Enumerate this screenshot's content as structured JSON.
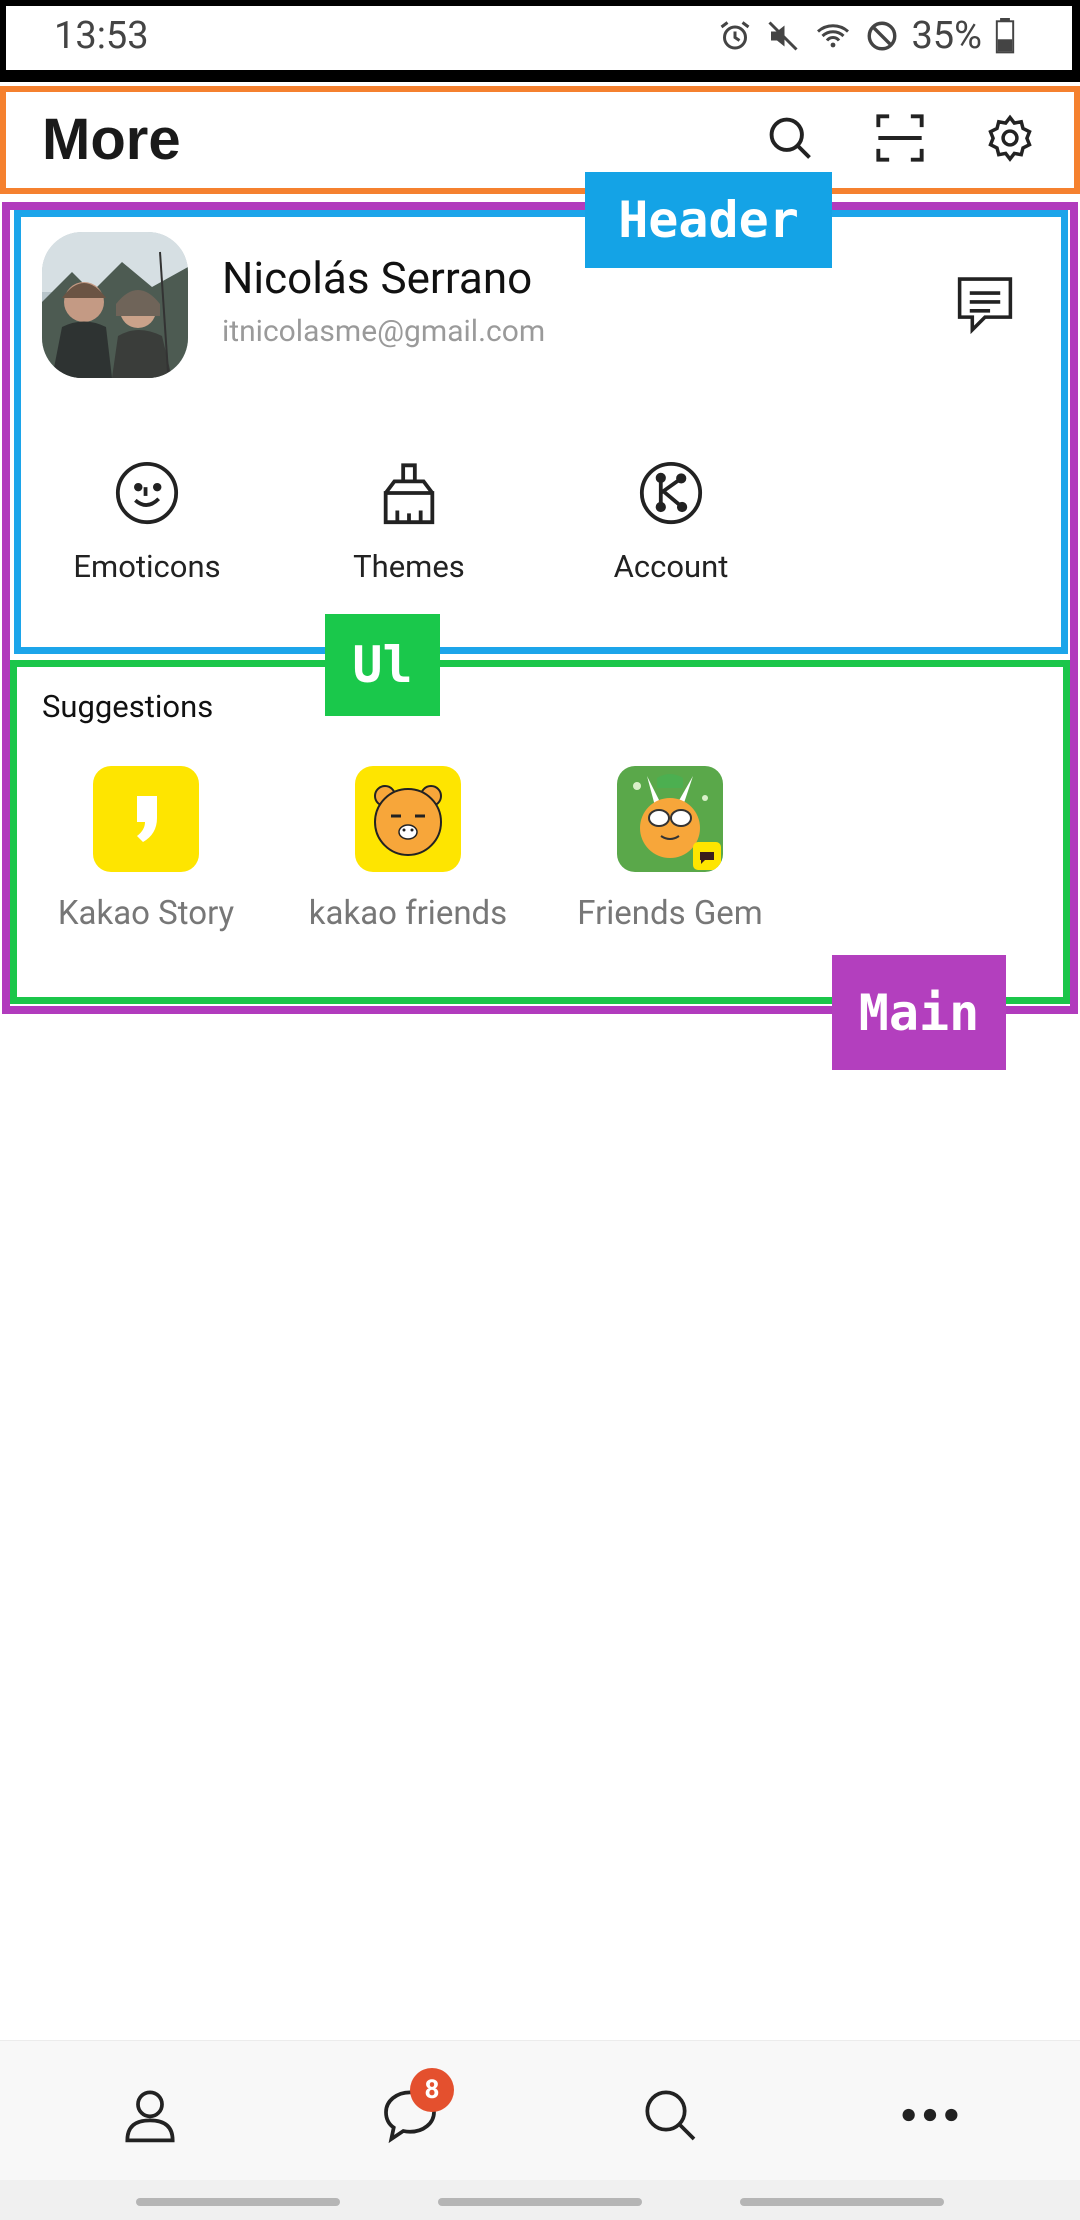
{
  "status_bar": {
    "time": "13:53",
    "battery": "35%",
    "icons": [
      "alarm-icon",
      "mute-icon",
      "wifi-icon",
      "do-not-disturb-icon",
      "battery-icon"
    ]
  },
  "header": {
    "title": "More",
    "actions": [
      "search-icon",
      "scan-icon",
      "settings-gear-icon"
    ]
  },
  "annotations": {
    "header": "Header",
    "ul": "Ul",
    "main": "Main"
  },
  "profile": {
    "name": "Nicolás Serrano",
    "email": "itnicolasme@gmail.com"
  },
  "quick_actions": [
    {
      "label": "Emoticons",
      "icon": "emoticon-smile-icon"
    },
    {
      "label": "Themes",
      "icon": "paintbrush-icon"
    },
    {
      "label": "Account",
      "icon": "kakao-account-icon"
    }
  ],
  "suggestions": {
    "title": "Suggestions",
    "items": [
      {
        "label": "Kakao Story",
        "icon": "kakao-story-app-icon"
      },
      {
        "label": "kakao friends",
        "icon": "kakao-friends-app-icon"
      },
      {
        "label": "Friends Gem",
        "icon": "friends-gem-app-icon"
      }
    ]
  },
  "bottom_nav": {
    "items": [
      "friends-person-icon",
      "chats-bubble-icon",
      "search-icon",
      "more-dots-icon"
    ],
    "chat_badge": "8",
    "selected": "more-dots-icon"
  },
  "colors": {
    "header_annotation": "#14a3e6",
    "ul_annotation": "#1ac84b",
    "main_annotation": "#b33fbe",
    "appbar_border": "#f5812f",
    "badge": "#e4502e",
    "kakao_yellow": "#fee500"
  }
}
